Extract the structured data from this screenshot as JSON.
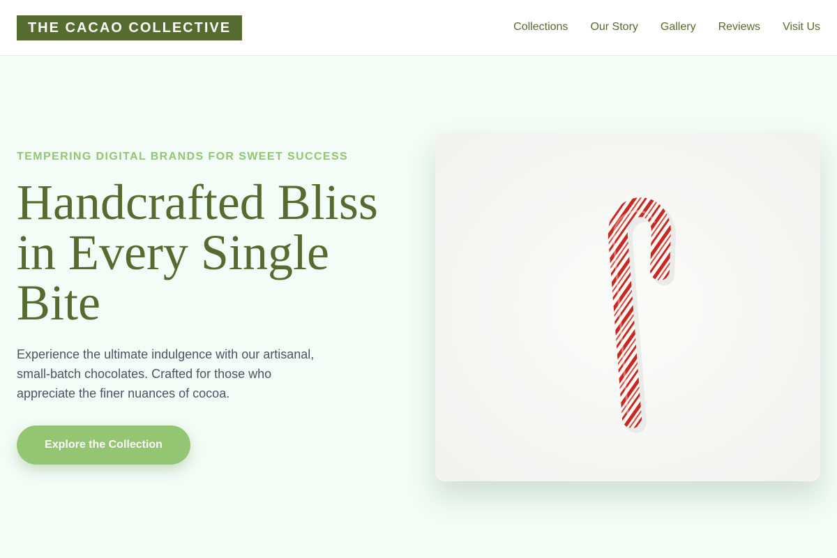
{
  "header": {
    "logo_text": "THE CACAO COLLECTIVE",
    "nav": [
      {
        "label": "Collections"
      },
      {
        "label": "Our Story"
      },
      {
        "label": "Gallery"
      },
      {
        "label": "Reviews"
      },
      {
        "label": "Visit Us"
      }
    ]
  },
  "hero": {
    "eyebrow": "TEMPERING DIGITAL BRANDS FOR SWEET SUCCESS",
    "headline": "Handcrafted Bliss in Every Single Bite",
    "description": "Experience the ultimate indulgence with our artisanal, small-batch chocolates. Crafted for those who appreciate the finer nuances of cocoa.",
    "cta_label": "Explore the Collection",
    "image": {
      "subject": "candy-cane-photo"
    }
  },
  "colors": {
    "brand_olive": "#556b2f",
    "accent_green": "#93c572",
    "page_background": "#f3fcf7",
    "body_text": "#4a5560",
    "candy_red": "#c8281e"
  }
}
